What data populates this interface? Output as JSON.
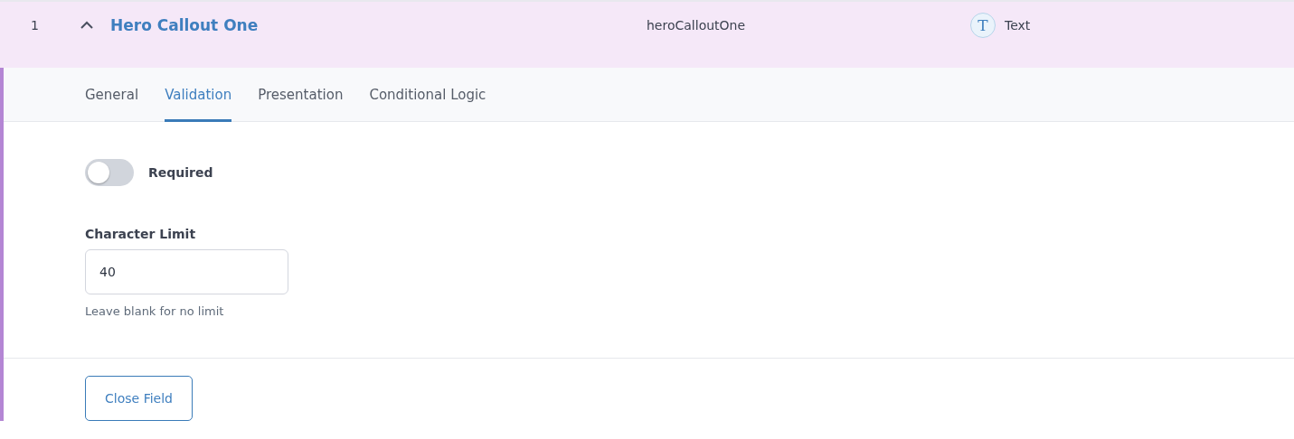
{
  "field_row": {
    "number": "1",
    "expanded": true,
    "title": "Hero Callout One",
    "key": "heroCalloutOne",
    "type_icon": "T",
    "type": "Text"
  },
  "tabs": [
    {
      "label": "General",
      "selected": false
    },
    {
      "label": "Validation",
      "selected": true
    },
    {
      "label": "Presentation",
      "selected": false
    },
    {
      "label": "Conditional Logic",
      "selected": false
    }
  ],
  "required": {
    "label": "Required",
    "on": false
  },
  "character_limit": {
    "label": "Character Limit",
    "value": "40",
    "hint": "Leave blank for no limit"
  },
  "close_button": "Close Field"
}
